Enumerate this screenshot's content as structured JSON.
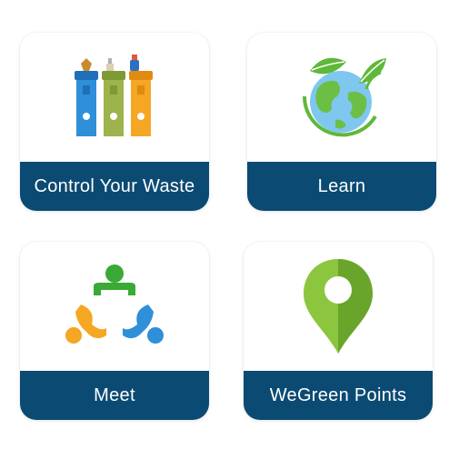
{
  "cards": [
    {
      "label": "Control Your Waste",
      "icon": "recycling-bins-icon"
    },
    {
      "label": "Learn",
      "icon": "globe-leaves-icon"
    },
    {
      "label": "Meet",
      "icon": "people-connect-icon"
    },
    {
      "label": "WeGreen Points",
      "icon": "location-pin-icon"
    }
  ],
  "colors": {
    "band": "#0b4a73",
    "blue": "#2f8fd8",
    "olive": "#9db34b",
    "orange": "#f5a623",
    "green": "#5fb83a",
    "pin": "#8cc63f"
  }
}
